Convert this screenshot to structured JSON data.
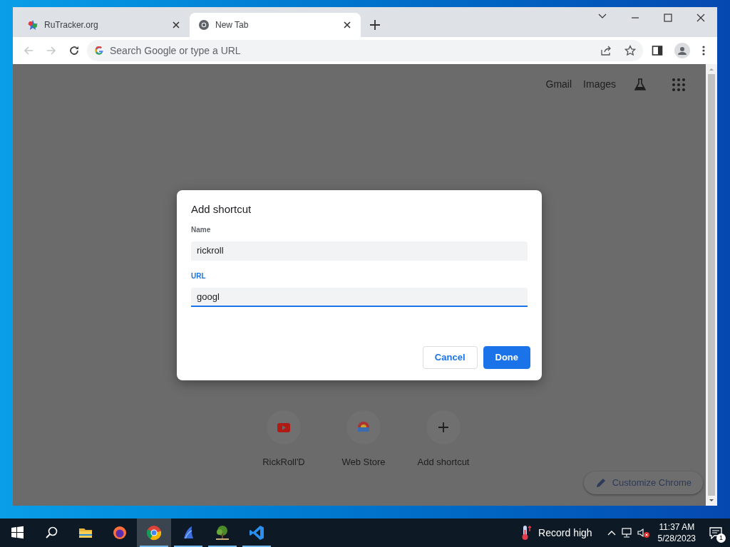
{
  "tabs": [
    {
      "title": "RuTracker.org",
      "selected": false,
      "kind": "star"
    },
    {
      "title": "New Tab",
      "selected": true,
      "kind": "chrome"
    }
  ],
  "address_bar": {
    "placeholder": "Search Google or type a URL"
  },
  "page": {
    "top_links": [
      "Gmail",
      "Images"
    ],
    "shortcuts": [
      {
        "label": "RickRoll'D",
        "kind": "youtube"
      },
      {
        "label": "Web Store",
        "kind": "webstore"
      },
      {
        "label": "Add shortcut",
        "kind": "add"
      }
    ],
    "customize_button": "Customize Chrome"
  },
  "dialog": {
    "title": "Add shortcut",
    "fields": [
      {
        "label": "Name",
        "value": "rickroll",
        "focused": false
      },
      {
        "label": "URL",
        "value": "googl",
        "focused": true
      }
    ],
    "buttons": [
      {
        "label": "Cancel",
        "kind": "secondary"
      },
      {
        "label": "Done",
        "kind": "primary"
      }
    ]
  },
  "taskbar": {
    "apps": [
      {
        "kind": "explorer",
        "running": false,
        "active": false
      },
      {
        "kind": "firefox",
        "running": false,
        "active": false
      },
      {
        "kind": "chrome",
        "running": true,
        "active": true
      },
      {
        "kind": "sail",
        "running": true,
        "active": false
      },
      {
        "kind": "tree",
        "running": true,
        "active": false
      },
      {
        "kind": "vscode",
        "running": true,
        "active": false
      }
    ],
    "weather": "Record high",
    "time": "11:37 AM",
    "date": "5/28/2023",
    "notifications": "1"
  }
}
